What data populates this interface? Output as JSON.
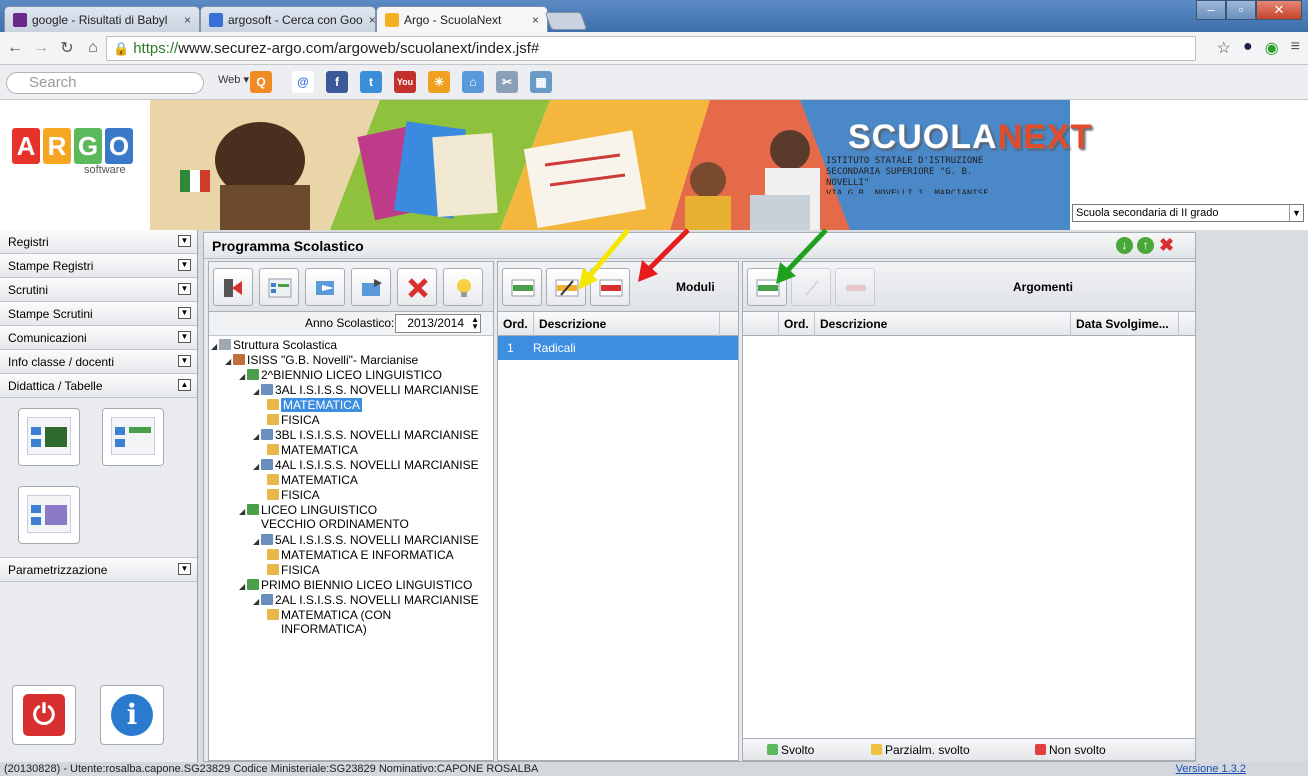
{
  "browser": {
    "tabs": [
      {
        "label": "google - Risultati di Babyl",
        "color": "#6b2a8a"
      },
      {
        "label": "argosoft - Cerca con Goo",
        "color": "#3a6fd8"
      },
      {
        "label": "Argo - ScuolaNext",
        "color": "#f5b020"
      }
    ],
    "close_glyph": "×",
    "url_https": "https://",
    "url_rest": "www.securez-argo.com/argoweb/scuolanext/index.jsf#",
    "search_placeholder": "Search",
    "search_web": "Web ▾"
  },
  "banner": {
    "logo_letters": [
      "A",
      "R",
      "G",
      "O"
    ],
    "logo_colors": [
      "#e7322a",
      "#f5a623",
      "#5cb85c",
      "#3a79c8"
    ],
    "logo_sub": "software",
    "brand_a": "SCUOLA",
    "brand_b": "NEXT",
    "istituto_lines": [
      "ISTITUTO STATALE D'ISTRUZIONE",
      "SECONDARIA SUPERIORE \"G. B.",
      "NOVELLI\"",
      "VIA G.B. NOVELLI 1, MARCIANISE"
    ],
    "school_select": "Scuola secondaria di II grado"
  },
  "left_menu": {
    "items": [
      {
        "label": "Registri"
      },
      {
        "label": "Stampe Registri"
      },
      {
        "label": "Scrutini"
      },
      {
        "label": "Stampe Scrutini"
      },
      {
        "label": "Comunicazioni"
      },
      {
        "label": "Info classe / docenti"
      },
      {
        "label": "Didattica / Tabelle"
      }
    ],
    "param_label": "Parametrizzazione"
  },
  "main": {
    "title": "Programma Scolastico",
    "anno_label": "Anno Scolastico:",
    "anno_value": "2013/2014",
    "tree": [
      {
        "label": "Struttura Scolastica",
        "indent": 0,
        "icon": "#a0a8b0"
      },
      {
        "label": "ISISS \"G.B. Novelli\"- Marcianise",
        "indent": 1,
        "icon": "#c0703a"
      },
      {
        "label": "2^BIENNIO LICEO LINGUISTICO",
        "indent": 2,
        "icon": "#4aa04a"
      },
      {
        "label": "3AL I.S.I.S.S. NOVELLI MARCIANISE",
        "indent": 3,
        "icon": "#6a8fbe"
      },
      {
        "label": "MATEMATICA",
        "indent": 4,
        "icon": "#e8b84a",
        "selected": true
      },
      {
        "label": "FISICA",
        "indent": 4,
        "icon": "#e8b84a"
      },
      {
        "label": "3BL I.S.I.S.S. NOVELLI MARCIANISE",
        "indent": 3,
        "icon": "#6a8fbe"
      },
      {
        "label": "MATEMATICA",
        "indent": 4,
        "icon": "#e8b84a"
      },
      {
        "label": "4AL I.S.I.S.S. NOVELLI MARCIANISE",
        "indent": 3,
        "icon": "#6a8fbe"
      },
      {
        "label": "MATEMATICA",
        "indent": 4,
        "icon": "#e8b84a"
      },
      {
        "label": "FISICA",
        "indent": 4,
        "icon": "#e8b84a"
      },
      {
        "label": "LICEO LINGUISTICO VECCHIO ORDINAMENTO",
        "indent": 2,
        "icon": "#4aa04a",
        "multi": true
      },
      {
        "label": "5AL I.S.I.S.S. NOVELLI MARCIANISE",
        "indent": 3,
        "icon": "#6a8fbe"
      },
      {
        "label": "MATEMATICA E INFORMATICA",
        "indent": 4,
        "icon": "#e8b84a"
      },
      {
        "label": "FISICA",
        "indent": 4,
        "icon": "#e8b84a"
      },
      {
        "label": "PRIMO BIENNIO LICEO LINGUISTICO",
        "indent": 2,
        "icon": "#4aa04a"
      },
      {
        "label": "2AL I.S.I.S.S. NOVELLI MARCIANISE",
        "indent": 3,
        "icon": "#6a8fbe"
      },
      {
        "label": "MATEMATICA (CON INFORMATICA)",
        "indent": 4,
        "icon": "#e8b84a",
        "multi": true
      }
    ],
    "moduli": {
      "title": "Moduli",
      "col_ord": "Ord.",
      "col_desc": "Descrizione",
      "rows": [
        {
          "ord": "1",
          "desc": "Radicali"
        }
      ]
    },
    "argomenti": {
      "title": "Argomenti",
      "col_ord": "Ord.",
      "col_desc": "Descrizione",
      "col_data": "Data Svolgime...",
      "legend": [
        {
          "label": "Svolto",
          "color": "#5cb85c"
        },
        {
          "label": "Parzialm. svolto",
          "color": "#f0c040"
        },
        {
          "label": "Non svolto",
          "color": "#e04040"
        }
      ]
    }
  },
  "status": {
    "text": "(20130828) - Utente:rosalba.capone.SG23829 Codice Ministeriale:SG23829 Nominativo:CAPONE ROSALBA",
    "version": "Versione 1.3.2"
  }
}
